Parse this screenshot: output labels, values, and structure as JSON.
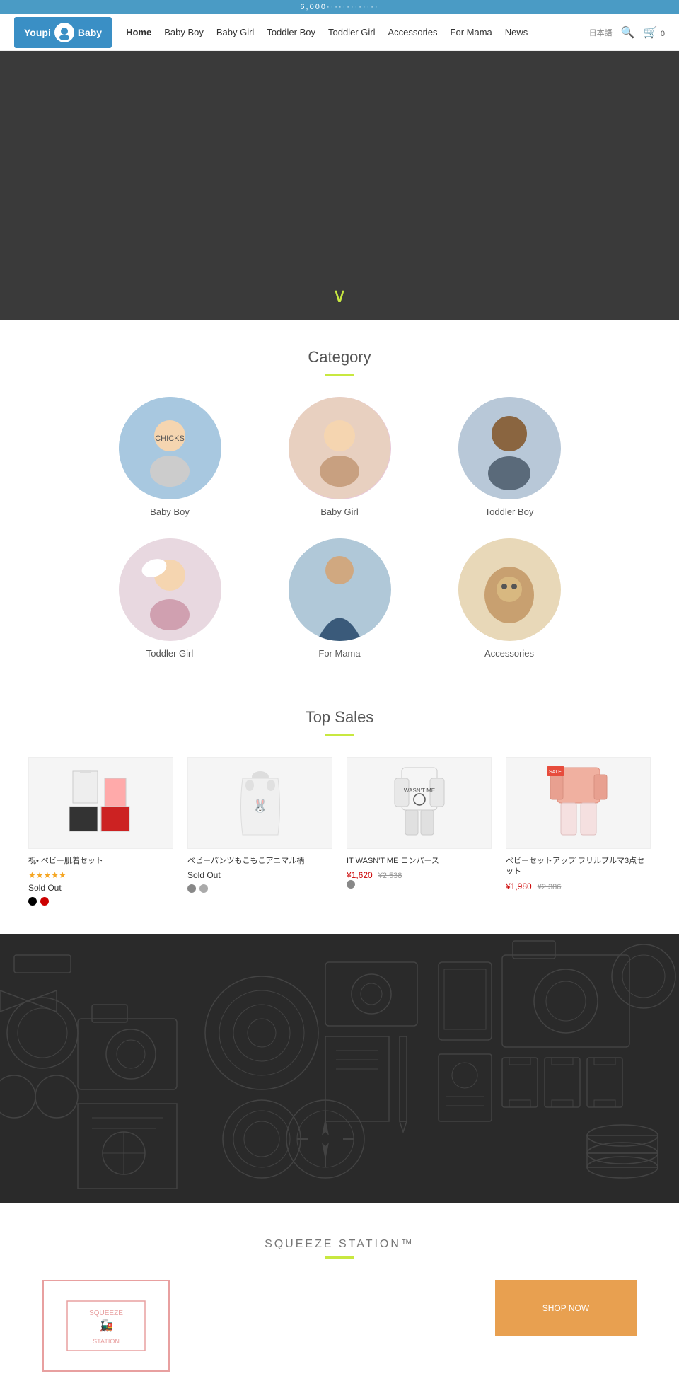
{
  "announcement": {
    "text": "6,000·············"
  },
  "header": {
    "logo_youpi": "Youpi",
    "logo_baby": "Baby",
    "nav_home": "Home",
    "nav_baby_boy": "Baby Boy",
    "nav_baby_girl": "Baby Girl",
    "nav_toddler_boy": "Toddler Boy",
    "nav_toddler_girl": "Toddler Girl",
    "nav_accessories": "Accessories",
    "nav_for_mama": "For Mama",
    "nav_news": "News",
    "lang": "日本語",
    "cart_count": "0"
  },
  "sections": {
    "category_title": "Category",
    "top_sales_title": "Top Sales",
    "squeeze_title": "SQUEEZE STATION™"
  },
  "categories": [
    {
      "label": "Baby Boy",
      "bg": "bg-blue"
    },
    {
      "label": "Baby Girl",
      "bg": "bg-pink"
    },
    {
      "label": "Toddler Boy",
      "bg": "bg-blue2"
    },
    {
      "label": "Toddler Girl",
      "bg": "bg-pink2"
    },
    {
      "label": "For Mama",
      "bg": "bg-blue3"
    },
    {
      "label": "Accessories",
      "bg": "bg-cream"
    }
  ],
  "products": [
    {
      "name": "祝• ベビー肌着セット",
      "stars": "★★★★★",
      "status": "Sold Out",
      "colors": [
        "#000000",
        "#cc0000"
      ],
      "price": null,
      "original_price": null,
      "has_badge": false
    },
    {
      "name": "ベビーパンツもこもこアニマル柄",
      "stars": null,
      "status": "Sold Out",
      "colors": [
        "#888888",
        "#aaaaaa"
      ],
      "price": null,
      "original_price": null,
      "has_badge": false
    },
    {
      "name": "IT WASN'T ME ロンパース",
      "stars": null,
      "status": null,
      "colors": [
        "#888888"
      ],
      "price": "¥1,620",
      "original_price": "¥2,538",
      "has_badge": false
    },
    {
      "name": "ベビーセットアップ フリルブルマ3点セット",
      "stars": null,
      "status": null,
      "colors": [],
      "price": "¥1,980",
      "original_price": "¥2,386",
      "has_badge": true,
      "badge_text": "SALE"
    }
  ],
  "icons": {
    "search": "🔍",
    "cart": "🛒",
    "chevron_down": "∨",
    "star": "★"
  }
}
